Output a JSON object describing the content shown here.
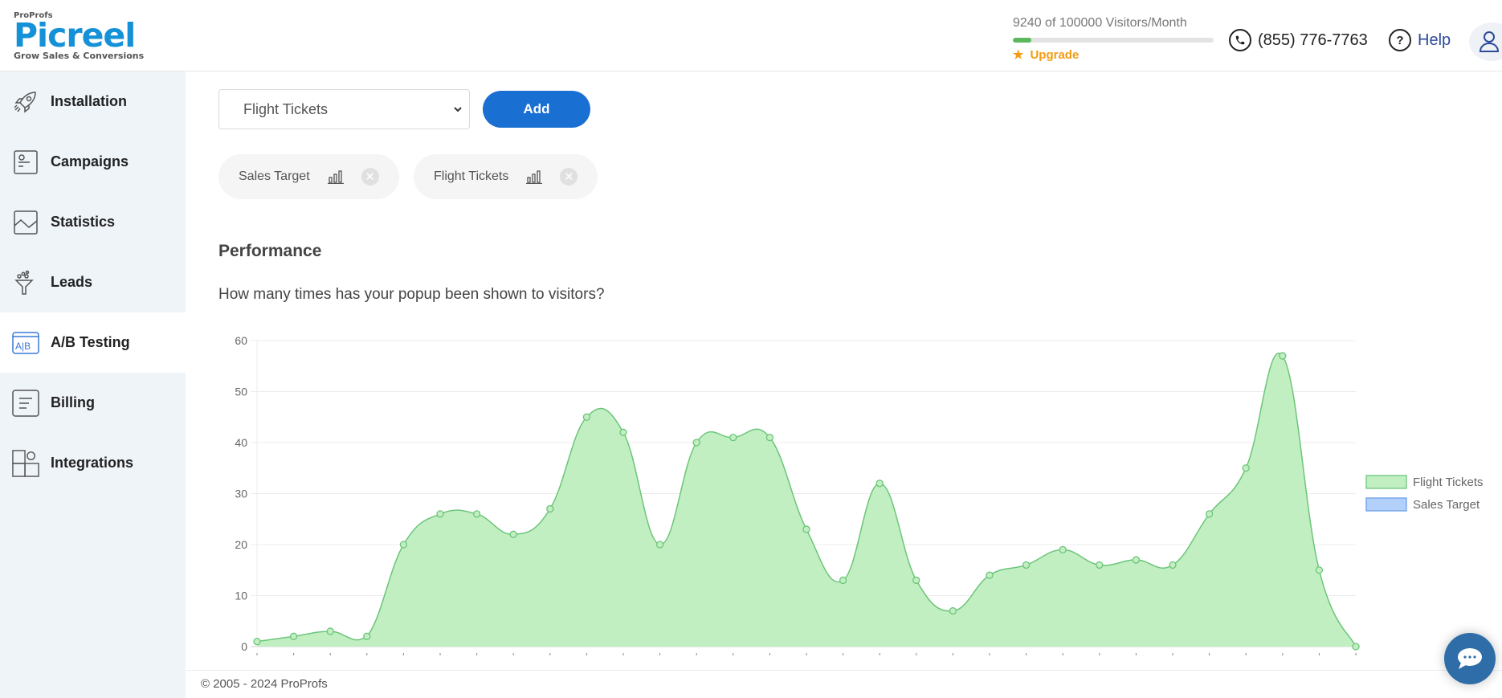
{
  "header": {
    "logo_top": "ProProfs",
    "logo_brand": "Picreel",
    "logo_tagline": "Grow Sales & Conversions",
    "visitors_text": "9240 of 100000 Visitors/Month",
    "visitors_used": 9240,
    "visitors_limit": 100000,
    "upgrade_label": "Upgrade",
    "phone": "(855) 776-7763",
    "help_label": "Help",
    "colors": {
      "brand": "#1591d8",
      "upgrade": "#f39c12",
      "progress": "#5cb85c",
      "help": "#2d4a9a"
    }
  },
  "sidebar": {
    "items": [
      {
        "label": "Installation",
        "icon": "rocket-icon",
        "active": false
      },
      {
        "label": "Campaigns",
        "icon": "campaign-card-icon",
        "active": false
      },
      {
        "label": "Statistics",
        "icon": "line-chart-icon",
        "active": false
      },
      {
        "label": "Leads",
        "icon": "funnel-icon",
        "active": false
      },
      {
        "label": "A/B Testing",
        "icon": "ab-test-icon",
        "active": true
      },
      {
        "label": "Billing",
        "icon": "billing-doc-icon",
        "active": false
      },
      {
        "label": "Integrations",
        "icon": "integrations-grid-icon",
        "active": false
      }
    ]
  },
  "main": {
    "select_value": "Flight Tickets",
    "add_label": "Add",
    "chips": [
      {
        "label": "Sales Target"
      },
      {
        "label": "Flight Tickets"
      }
    ],
    "performance_title": "Performance",
    "performance_question": "How many times has your popup been shown to visitors?"
  },
  "chart_data": {
    "type": "area",
    "title": "",
    "xlabel": "",
    "ylabel": "",
    "ylim": [
      0,
      60
    ],
    "yticks": [
      0,
      10,
      20,
      30,
      40,
      50,
      60
    ],
    "grid": true,
    "legend_position": "right",
    "x": [
      1,
      2,
      3,
      4,
      5,
      6,
      7,
      8,
      9,
      10,
      11,
      12,
      13,
      14,
      15,
      16,
      17,
      18,
      19,
      20,
      21,
      22,
      23,
      24,
      25,
      26,
      27,
      28,
      29,
      30,
      31
    ],
    "x_tick_labels_visible": false,
    "series": [
      {
        "name": "Flight Tickets",
        "color": "#6cc57a",
        "fill": "#c2efc2",
        "values": [
          1,
          2,
          3,
          2,
          20,
          26,
          26,
          22,
          27,
          45,
          42,
          20,
          40,
          41,
          41,
          23,
          13,
          32,
          13,
          7,
          14,
          16,
          19,
          16,
          17,
          16,
          26,
          35,
          57,
          15,
          0
        ]
      },
      {
        "name": "Sales Target",
        "color": "#6a9ee8",
        "fill": "#b3d0fb",
        "values": []
      }
    ]
  },
  "footer": {
    "copyright": "© 2005 - 2024 ProProfs"
  }
}
